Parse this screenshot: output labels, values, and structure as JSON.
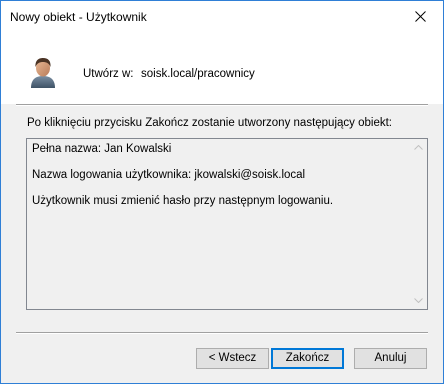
{
  "window": {
    "title": "Nowy obiekt - Użytkownik"
  },
  "header": {
    "create_label": "Utwórz w:",
    "create_path": "soisk.local/pracownicy"
  },
  "info_text": "Po kliknięciu przycisku Zakończ zostanie utworzony następujący obiekt:",
  "summary": {
    "lines": [
      "Pełna nazwa: Jan Kowalski",
      "Nazwa logowania użytkownika: jkowalski@soisk.local",
      "Użytkownik musi zmienić hasło przy następnym logowaniu."
    ]
  },
  "buttons": {
    "back": "< Wstecz",
    "finish": "Zakończ",
    "cancel": "Anuluj"
  },
  "icons": {
    "close": "close-icon",
    "avatar": "user-icon"
  },
  "colors": {
    "accent": "#0078d7",
    "window_border": "#2f7fd6"
  }
}
